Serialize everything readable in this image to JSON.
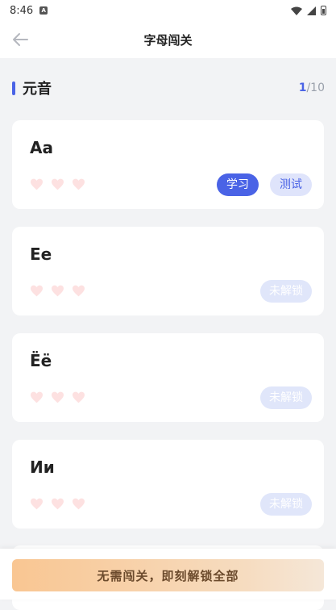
{
  "status_bar": {
    "time": "8:46",
    "notif_glyph": "A"
  },
  "header": {
    "title": "字母闯关",
    "back_icon": "arrow-left-icon"
  },
  "section": {
    "title": "元音",
    "current": "1",
    "total": "/10",
    "accent": "#4a63e6"
  },
  "lessons": [
    {
      "letter": "Aa",
      "hearts": 3,
      "learn_label": "学习",
      "test_label": "测试"
    },
    {
      "letter": "Ee",
      "hearts": 3,
      "locked_label": "未解锁"
    },
    {
      "letter": "Ёё",
      "hearts": 3,
      "locked_label": "未解锁"
    },
    {
      "letter": "Ии",
      "hearts": 3,
      "locked_label": "未解锁"
    }
  ],
  "bottom": {
    "unlock_all_label": "无需闯关，即刻解锁全部"
  },
  "colors": {
    "heart": "#fde1e1",
    "learn_bg": "#4a63e6",
    "test_bg": "#dfe4fb",
    "locked_bg": "#e0e6fa",
    "unlock_from": "#f9c692",
    "unlock_to": "#f5e7d8"
  }
}
